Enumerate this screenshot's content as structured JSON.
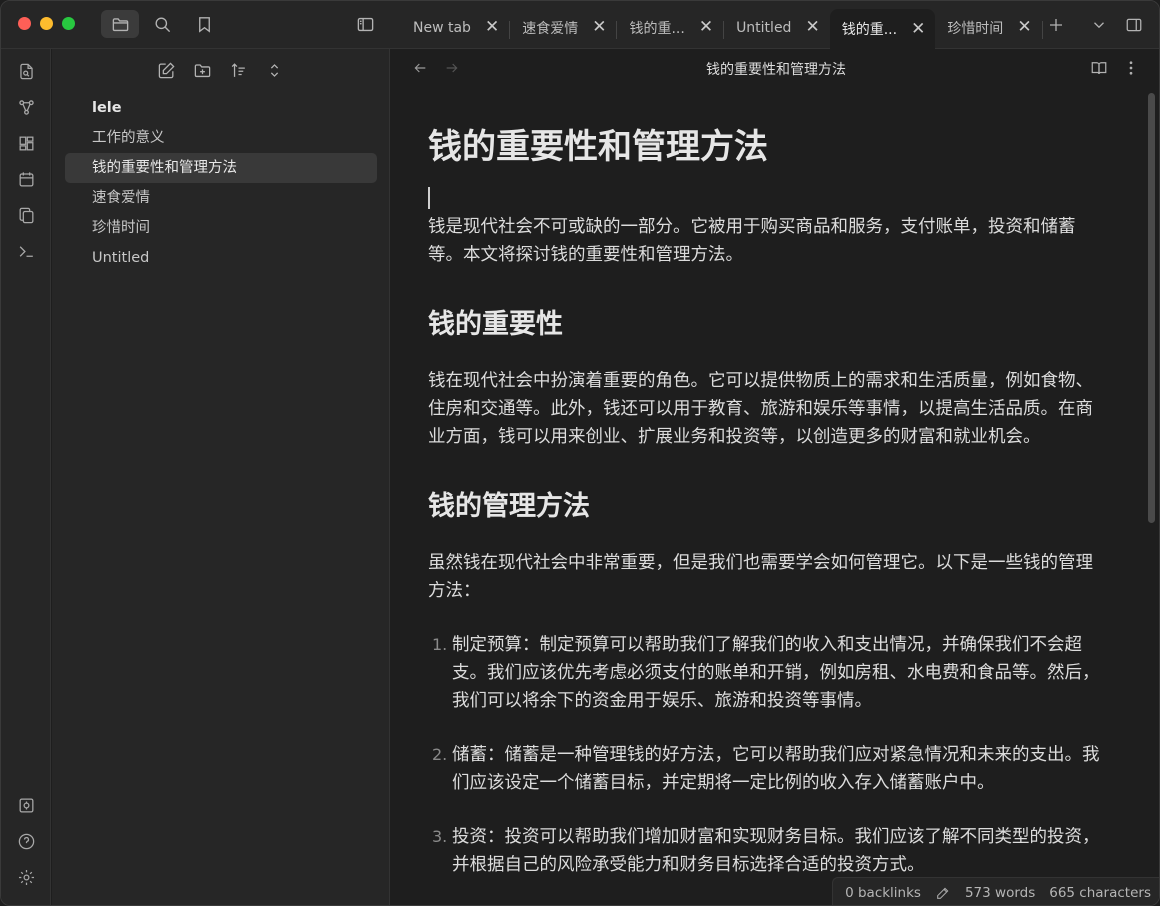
{
  "tabs": [
    {
      "label": "New tab",
      "active": false
    },
    {
      "label": "速食爱情",
      "active": false
    },
    {
      "label": "钱的重...",
      "active": false
    },
    {
      "label": "Untitled",
      "active": false
    },
    {
      "label": "钱的重...",
      "active": true
    },
    {
      "label": "珍惜时间",
      "active": false
    }
  ],
  "tab_close_glyph": "✕",
  "sidebar": {
    "vault_name": "lele",
    "files": [
      "工作的意义",
      "钱的重要性和管理方法",
      "速食爱情",
      "珍惜时间",
      "Untitled"
    ],
    "active_file_index": 1
  },
  "header": {
    "title": "钱的重要性和管理方法"
  },
  "document": {
    "h1": "钱的重要性和管理方法",
    "intro": "钱是现代社会不可或缺的一部分。它被用于购买商品和服务，支付账单，投资和储蓄等。本文将探讨钱的重要性和管理方法。",
    "section1_title": "钱的重要性",
    "section1_body": "钱在现代社会中扮演着重要的角色。它可以提供物质上的需求和生活质量，例如食物、住房和交通等。此外，钱还可以用于教育、旅游和娱乐等事情，以提高生活品质。在商业方面，钱可以用来创业、扩展业务和投资等，以创造更多的财富和就业机会。",
    "section2_title": "钱的管理方法",
    "section2_body": "虽然钱在现代社会中非常重要，但是我们也需要学会如何管理它。以下是一些钱的管理方法：",
    "list": [
      {
        "num": "1.",
        "text": "制定预算：制定预算可以帮助我们了解我们的收入和支出情况，并确保我们不会超支。我们应该优先考虑必须支付的账单和开销，例如房租、水电费和食品等。然后，我们可以将余下的资金用于娱乐、旅游和投资等事情。"
      },
      {
        "num": "2.",
        "text": "储蓄：储蓄是一种管理钱的好方法，它可以帮助我们应对紧急情况和未来的支出。我们应该设定一个储蓄目标，并定期将一定比例的收入存入储蓄账户中。"
      },
      {
        "num": "3.",
        "text": "投资：投资可以帮助我们增加财富和实现财务目标。我们应该了解不同类型的投资，并根据自己的风险承受能力和财务目标选择合适的投资方式。"
      }
    ]
  },
  "status": {
    "backlinks": "0 backlinks",
    "words": "573 words",
    "characters": "665 characters"
  },
  "colors": {
    "background": "#1e1e1e",
    "panel": "#262626",
    "active_item": "#393939"
  }
}
